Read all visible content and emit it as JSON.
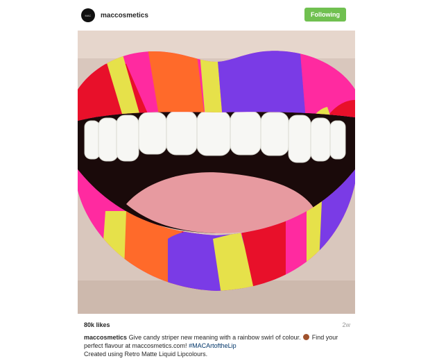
{
  "header": {
    "username": "maccosmetics",
    "avatar_text": "MAC",
    "follow_label": "Following"
  },
  "post": {
    "likes": "80k likes",
    "time_ago": "2w",
    "caption": {
      "username": "maccosmetics",
      "text_1": "Give candy striper new meaning with a rainbow swirl of colour.",
      "emoji": "lipstick-emoji",
      "text_2": "Find your perfect flavour at maccosmetics.com!",
      "hashtag": "#MACArtoftheLip",
      "line_3": "Created using Retro Matte Liquid Lipcolours."
    }
  },
  "colors": {
    "follow_button": "#70c050",
    "hashtag": "#003569",
    "lip_pink": "#ff2aa0",
    "lip_purple": "#7a3be6",
    "lip_yellow": "#e6e14a",
    "lip_orange": "#ff6a2a",
    "lip_red": "#e8102a"
  }
}
